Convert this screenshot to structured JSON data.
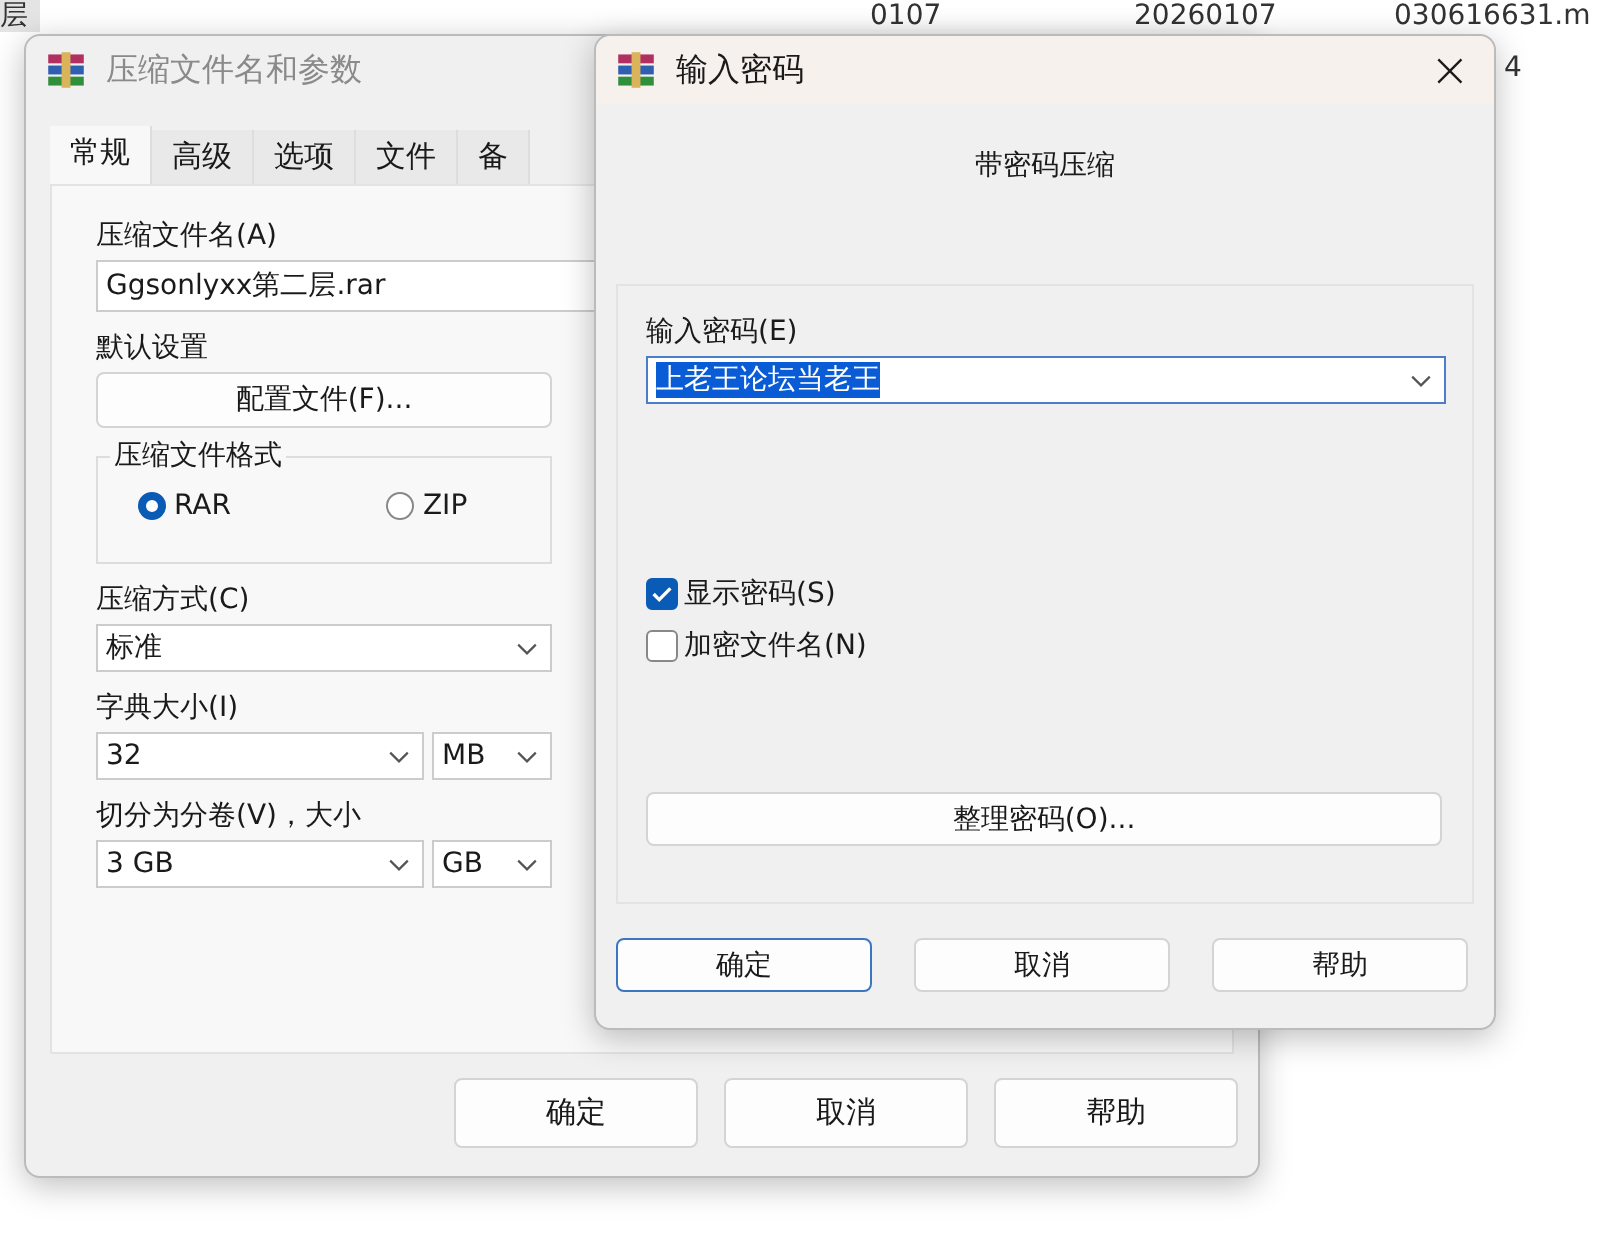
{
  "background_files": {
    "row_1": {
      "column_1": "层",
      "column_2": "0107",
      "column_3": "20260107",
      "column_4": "030616631.m"
    },
    "row_2": {
      "column_4": "4"
    }
  },
  "archive_window": {
    "title": "压缩文件名和参数",
    "tabs": [
      {
        "label": "常规",
        "selected": true
      },
      {
        "label": "高级",
        "selected": false
      },
      {
        "label": "选项",
        "selected": false
      },
      {
        "label": "文件",
        "selected": false
      },
      {
        "label": "备",
        "selected": false
      }
    ],
    "archive_name": {
      "label": "压缩文件名(A)",
      "value": "Ggsonlyxx第二层.rar"
    },
    "default_settings": {
      "label": "默认设置",
      "button": "配置文件(F)..."
    },
    "format": {
      "label": "压缩文件格式",
      "options": [
        {
          "label": "RAR",
          "selected": true
        },
        {
          "label": "ZIP",
          "selected": false
        }
      ]
    },
    "method": {
      "label": "压缩方式(C)",
      "value": "标准"
    },
    "dictionary": {
      "label": "字典大小(I)",
      "value": "32",
      "unit": "MB"
    },
    "split": {
      "label": "切分为分卷(V)，大小",
      "value": "3 GB",
      "unit": "GB"
    },
    "buttons": [
      "确定",
      "取消",
      "帮助"
    ]
  },
  "password_dialog": {
    "title": "输入密码",
    "close": "×",
    "heading": "带密码压缩",
    "password": {
      "label": "输入密码(E)",
      "value": "上老王论坛当老王"
    },
    "options": [
      {
        "label": "显示密码(S)",
        "checked": true
      },
      {
        "label": "加密文件名(N)",
        "checked": false
      }
    ],
    "organize_button": "整理密码(O)...",
    "buttons": [
      {
        "label": "确定",
        "default": true
      },
      {
        "label": "取消",
        "default": false
      },
      {
        "label": "帮助",
        "default": false
      }
    ]
  }
}
